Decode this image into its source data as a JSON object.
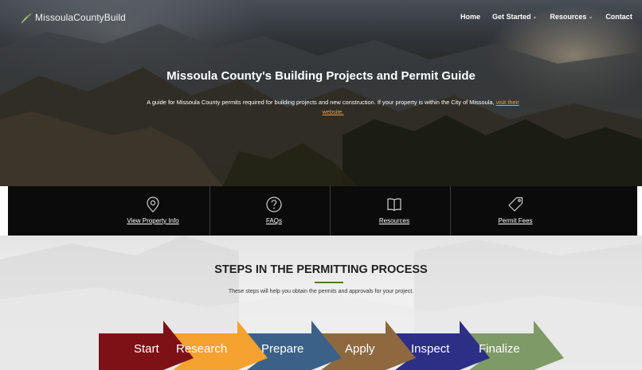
{
  "header": {
    "logo_text": "MissoulaCountyBuild",
    "nav": [
      {
        "label": "Home",
        "chevron": false
      },
      {
        "label": "Get Started",
        "chevron": true
      },
      {
        "label": "Resources",
        "chevron": true
      },
      {
        "label": "Contact",
        "chevron": false
      }
    ]
  },
  "hero": {
    "title": "Missoula County's Building Projects and Permit Guide",
    "description": "A guide for Missoula County permits required for building projects and new construction. If your property is within the City of Missoula,",
    "link_text": "visit their website."
  },
  "quick_links": [
    {
      "label": "View Property Info",
      "icon": "map-pin-icon"
    },
    {
      "label": "FAQs",
      "icon": "question-circle-icon"
    },
    {
      "label": "Resources",
      "icon": "book-icon"
    },
    {
      "label": "Permit Fees",
      "icon": "tag-icon"
    }
  ],
  "steps": {
    "title": "STEPS IN THE PERMITTING PROCESS",
    "subtitle": "These steps will help you obtain the permits and approvals for your project.",
    "items": [
      {
        "label": "Start",
        "color": "#7d1116"
      },
      {
        "label": "Research",
        "color": "#f5a230"
      },
      {
        "label": "Prepare",
        "color": "#3c6189"
      },
      {
        "label": "Apply",
        "color": "#8e6940"
      },
      {
        "label": "Inspect",
        "color": "#2d2f86"
      },
      {
        "label": "Finalize",
        "color": "#7e9a66"
      }
    ]
  },
  "colors": {
    "quickbar_bg": "#0b0b0b",
    "link_accent": "#e2a24b",
    "rule_green": "#4f7a2f"
  }
}
